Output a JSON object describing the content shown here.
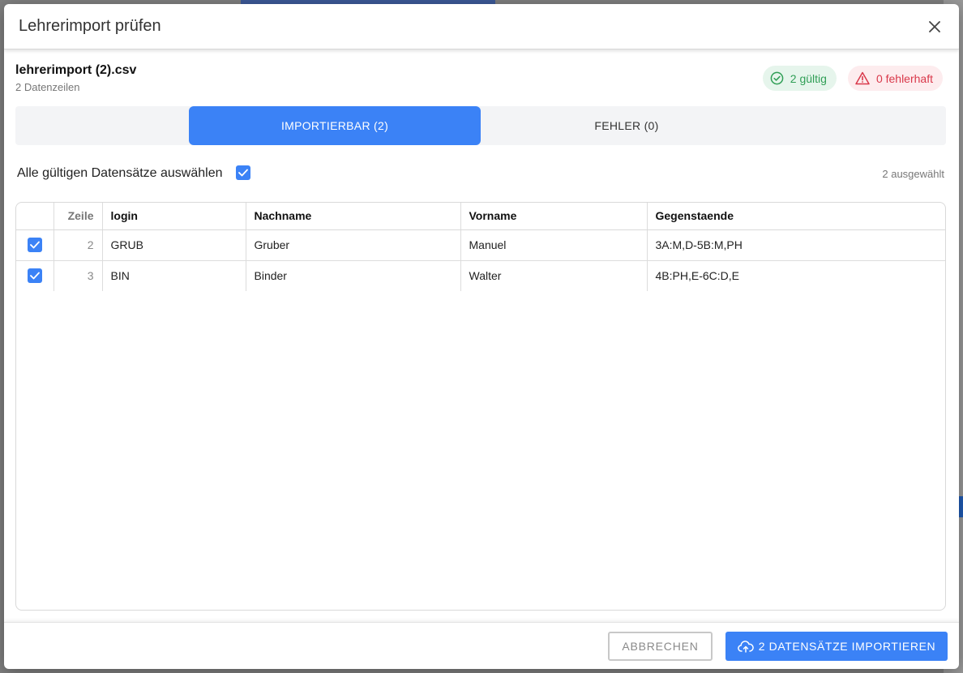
{
  "dialog": {
    "title": "Lehrerimport prüfen"
  },
  "file": {
    "name": "lehrerimport (2).csv",
    "rows_label": "2 Datenzeilen"
  },
  "badges": {
    "valid": "2 gültig",
    "invalid": "0 fehlerhaft"
  },
  "tabs": [
    {
      "label": "IMPORTIERBAR (2)",
      "active": true
    },
    {
      "label": "FEHLER (0)",
      "active": false
    }
  ],
  "selection": {
    "select_all_label": "Alle gültigen Datensätze auswählen",
    "select_all_checked": true,
    "selected_count": "2 ausgewählt"
  },
  "table": {
    "headers": [
      "",
      "Zeile",
      "login",
      "Nachname",
      "Vorname",
      "Gegenstaende"
    ],
    "rows": [
      {
        "checked": true,
        "zeile": "2",
        "login": "GRUB",
        "nachname": "Gruber",
        "vorname": "Manuel",
        "gegenstaende": "3A:M,D-5B:M,PH"
      },
      {
        "checked": true,
        "zeile": "3",
        "login": "BIN",
        "nachname": "Binder",
        "vorname": "Walter",
        "gegenstaende": "4B:PH,E-6C:D,E"
      }
    ]
  },
  "footer": {
    "cancel_label": "ABBRECHEN",
    "import_label": "2 DATENSÄTZE IMPORTIEREN"
  },
  "colors": {
    "accent": "#3b82f6",
    "valid": "#2f9e55",
    "invalid": "#d9384a"
  },
  "icons": {
    "close": "close-icon",
    "valid": "check-circle-icon",
    "invalid": "warning-triangle-icon",
    "checkbox": "checkmark-icon",
    "import": "cloud-upload-icon"
  }
}
